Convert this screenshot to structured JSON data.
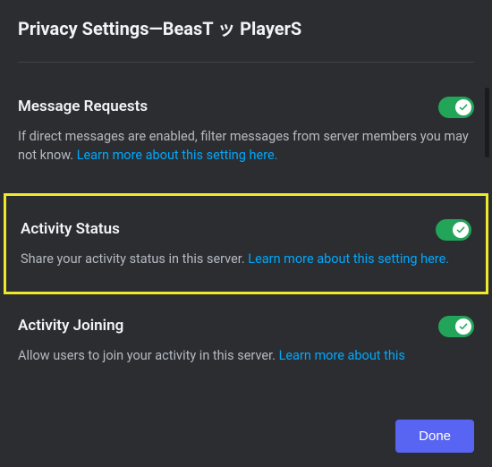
{
  "header": {
    "title": "Privacy Settings—BeasT ッ PlayerS"
  },
  "sections": {
    "messageRequests": {
      "title": "Message Requests",
      "desc": "If direct messages are enabled, filter messages from server members you may not know. ",
      "link": "Learn more about this setting here."
    },
    "activityStatus": {
      "title": "Activity Status",
      "desc": "Share your activity status in this server. ",
      "link": "Learn more about this setting here."
    },
    "activityJoining": {
      "title": "Activity Joining",
      "desc": "Allow users to join your activity in this server. ",
      "link": "Learn more about this"
    }
  },
  "footer": {
    "done": "Done"
  }
}
